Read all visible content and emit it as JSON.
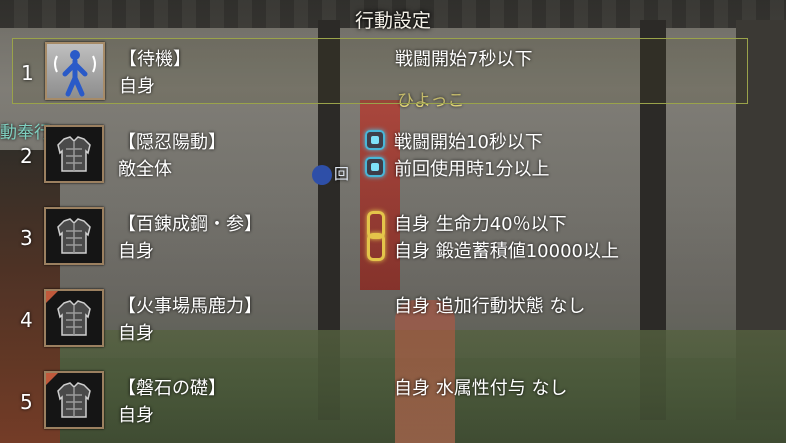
{
  "screen": {
    "title": "行動設定"
  },
  "background": {
    "npc_name": "動奉行",
    "npc_tag": "回",
    "floating_text": "ひよっこ"
  },
  "rows": [
    {
      "number": "1",
      "icon": "waiting-figure-icon",
      "name": "【待機】",
      "target": "自身",
      "conditions": [
        "戦闘開始7秒以下"
      ],
      "marker": "none",
      "selected": true
    },
    {
      "number": "2",
      "icon": "armor-icon",
      "name": "【隠忍陽動】",
      "target": "敵全体",
      "conditions": [
        "戦闘開始10秒以下",
        "前回使用時1分以上"
      ],
      "marker": "or",
      "selected": false
    },
    {
      "number": "3",
      "icon": "armor-icon",
      "name": "【百錬成鋼・参】",
      "target": "自身",
      "conditions": [
        "自身 生命力40％以下",
        "自身 鍛造蓄積値10000以上"
      ],
      "marker": "and",
      "selected": false
    },
    {
      "number": "4",
      "icon": "armor-icon",
      "name": "【火事場馬鹿力】",
      "target": "自身",
      "conditions": [
        "自身 追加行動状態 なし"
      ],
      "marker": "none",
      "selected": false
    },
    {
      "number": "5",
      "icon": "armor-icon",
      "name": "【磐石の礎】",
      "target": "自身",
      "conditions": [
        "自身 水属性付与 なし"
      ],
      "marker": "none",
      "selected": false
    }
  ],
  "colors": {
    "selection_border": "#9aa34a",
    "or_marker": "#48b6d8",
    "and_marker": "#e4c44a",
    "icon_frame": "#9b8060"
  }
}
